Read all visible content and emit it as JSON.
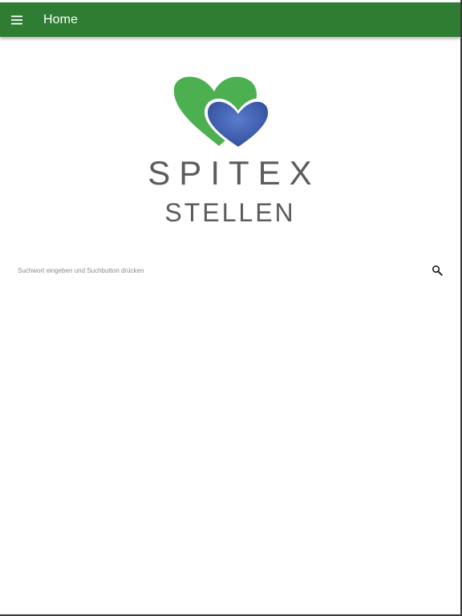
{
  "appbar": {
    "title": "Home",
    "menu_icon": "hamburger-menu-icon",
    "color": "#2e7d32"
  },
  "logo": {
    "line1": "SPITEX",
    "line2": "STELLEN",
    "heart_colors": {
      "back": "#4caf50",
      "front": "#3f5fb0"
    }
  },
  "search": {
    "placeholder": "Suchwort eingeben und Suchbutton drücken",
    "value": "",
    "button_icon": "search-icon"
  }
}
